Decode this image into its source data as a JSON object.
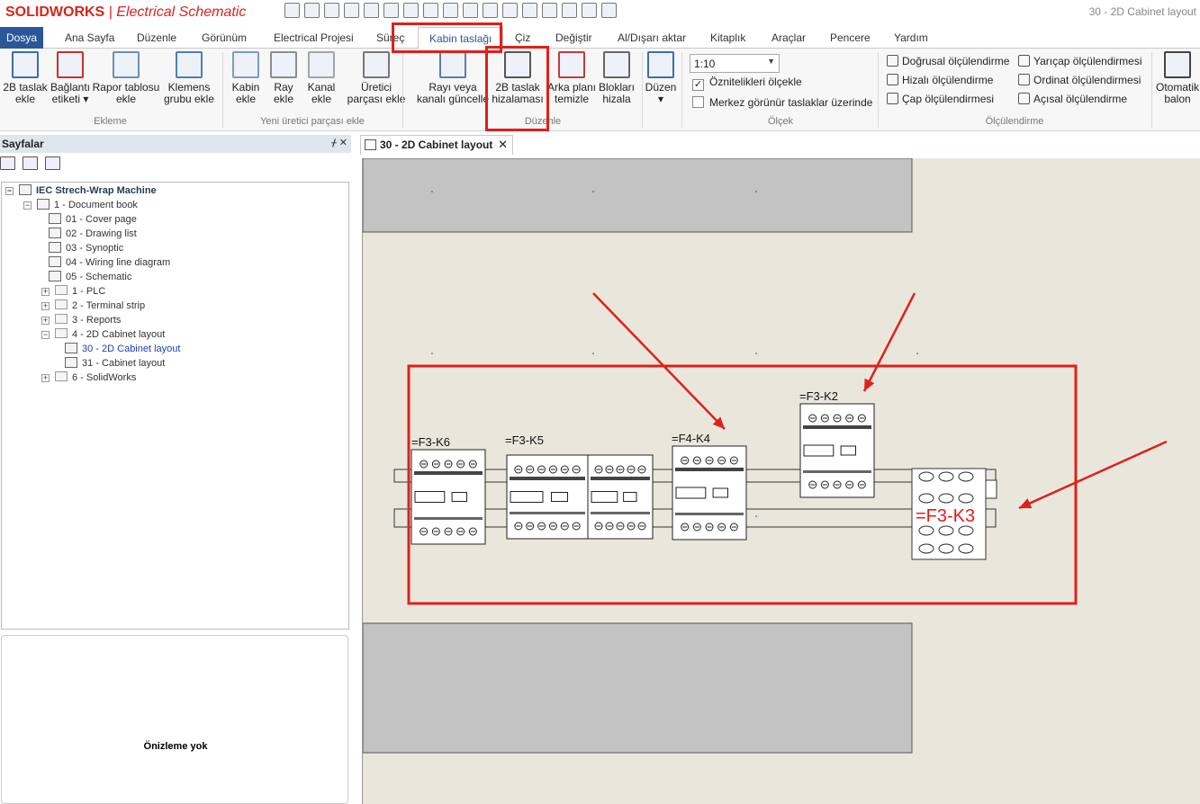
{
  "app": {
    "logo_brand": "SOLIDWORKS",
    "logo_product": "Electrical Schematic",
    "window_title": "30 - 2D Cabinet layout",
    "brand_color": "#d9241c",
    "accent_color": "#2b579a"
  },
  "tabs": [
    "Dosya",
    "Ana Sayfa",
    "Düzenle",
    "Görünüm",
    "Electrical Projesi",
    "Süreç",
    "Kabin taslağı",
    "Çiz",
    "Değiştir",
    "Al/Dışarı aktar",
    "Kitaplık",
    "Araçlar",
    "Pencere",
    "Yardım"
  ],
  "active_tab": "Kabin taslağı",
  "ribbon": {
    "buttons": [
      {
        "l1": "2B taslak",
        "l2": "ekle",
        "icon": "add-2d-layout-icon"
      },
      {
        "l1": "Bağlantı",
        "l2": "etiketi ▾",
        "icon": "connection-label-icon"
      },
      {
        "l1": "Rapor tablosu",
        "l2": "ekle",
        "icon": "report-table-icon"
      },
      {
        "l1": "Klemens",
        "l2": "grubu ekle",
        "icon": "terminal-strip-icon"
      },
      {
        "l1": "Kabin",
        "l2": "ekle",
        "icon": "cabinet-icon"
      },
      {
        "l1": "Ray",
        "l2": "ekle",
        "icon": "rail-icon"
      },
      {
        "l1": "Kanal",
        "l2": "ekle",
        "icon": "duct-icon"
      },
      {
        "l1": "Üretici",
        "l2": "parçası ekle",
        "icon": "wrench-icon"
      },
      {
        "l1": "Rayı veya",
        "l2": "kanalı güncelle",
        "icon": "update-rail-icon"
      },
      {
        "l1": "2B taslak",
        "l2": "hizalaması",
        "icon": "align-2d-icon"
      },
      {
        "l1": "Arka planı",
        "l2": "temizle",
        "icon": "clear-background-icon"
      },
      {
        "l1": "Blokları",
        "l2": "hizala",
        "icon": "align-blocks-icon"
      },
      {
        "l1": "Düzen",
        "l2": "▾",
        "icon": "layout-icon"
      },
      {
        "l1": "Otomatik",
        "l2": "balon",
        "icon": "auto-balloon-icon"
      }
    ],
    "groups": [
      "Ekleme",
      "Yeni üretici parçası ekle",
      "Düzenle",
      "Ölçek",
      "Ölçülendirme"
    ],
    "scale_value": "1:10",
    "checkbox1": {
      "label": "Öznitelikleri ölçekle",
      "checked": true
    },
    "checkbox2": {
      "label": "Merkez görünür taslaklar üzerinde",
      "checked": false
    },
    "dims": [
      "Doğrusal ölçülendirme",
      "Hizalı ölçülendirme",
      "Çap ölçülendirmesi",
      "Yarıçap ölçülendirmesi",
      "Ordinat ölçülendirmesi",
      "Açısal ölçülendirme"
    ]
  },
  "panel": {
    "title": "Sayfalar",
    "pin": "ᚋ ✕",
    "preview_text": "Önizleme yok",
    "tree": [
      {
        "label": "IEC Strech-Wrap Machine",
        "root": true
      },
      {
        "label": "1 - Document book"
      },
      {
        "label": "01 - Cover page"
      },
      {
        "label": "02 - Drawing list"
      },
      {
        "label": "03 - Synoptic"
      },
      {
        "label": "04 - Wiring line diagram"
      },
      {
        "label": "05 - Schematic"
      },
      {
        "label": "1 - PLC"
      },
      {
        "label": "2 - Terminal strip"
      },
      {
        "label": "3 - Reports"
      },
      {
        "label": "4 - 2D Cabinet layout"
      },
      {
        "label": "30 - 2D Cabinet layout",
        "selected": true
      },
      {
        "label": "31 - Cabinet layout"
      },
      {
        "label": "6 - SolidWorks"
      }
    ]
  },
  "doc_tab": {
    "label": "30 - 2D Cabinet layout",
    "close": "✕"
  },
  "canvas": {
    "components": [
      {
        "tag": "=F3-K6"
      },
      {
        "tag": "=F3-K5"
      },
      {
        "tag": "=F4-K4"
      },
      {
        "tag": "=F3-K2"
      },
      {
        "tag": "=F3-K3",
        "highlighted": true
      }
    ],
    "annotation_color": "#e0201a"
  }
}
